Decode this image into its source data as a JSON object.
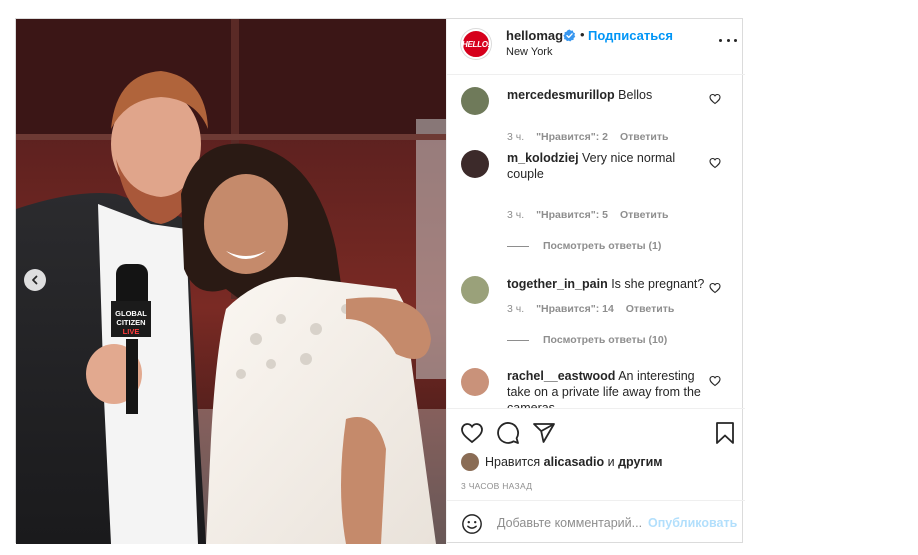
{
  "header": {
    "brand_avatar_text": "HELLO!",
    "username": "hellomag",
    "separator": "•",
    "follow_label": "Подписаться",
    "location": "New York",
    "accent_color": "#0095f6",
    "brand_color": "#d6001c"
  },
  "photo": {
    "microphone_text": "GLOBAL CITIZEN LIVE"
  },
  "comments": [
    {
      "username": "mercedesmurillop",
      "text": "Bellos",
      "time": "3 ч.",
      "likes": "\"Нравится\": 2",
      "reply": "Ответить",
      "replies": ""
    },
    {
      "username": "m_kolodziej",
      "text": "Very nice normal couple",
      "time": "3 ч.",
      "likes": "\"Нравится\": 5",
      "reply": "Ответить",
      "replies": "Посмотреть ответы (1)"
    },
    {
      "username": "together_in_pain",
      "text": "Is she pregnant?",
      "time": "3 ч.",
      "likes": "\"Нравится\": 14",
      "reply": "Ответить",
      "replies": "Посмотреть ответы (10)"
    },
    {
      "username": "rachel__eastwood",
      "text": "An interesting take on a private life away from the cameras...",
      "time": "",
      "likes": "",
      "reply": "",
      "replies": ""
    }
  ],
  "actions": {
    "liked_prefix": "Нравится",
    "liked_user": "alicasadio",
    "liked_and": "и",
    "liked_others": "другим",
    "posted_time": "3 ЧАСОВ НАЗАД"
  },
  "add_comment": {
    "placeholder": "Добавьте комментарий...",
    "publish_label": "Опубликовать",
    "publish_color": "#b2dffc"
  }
}
